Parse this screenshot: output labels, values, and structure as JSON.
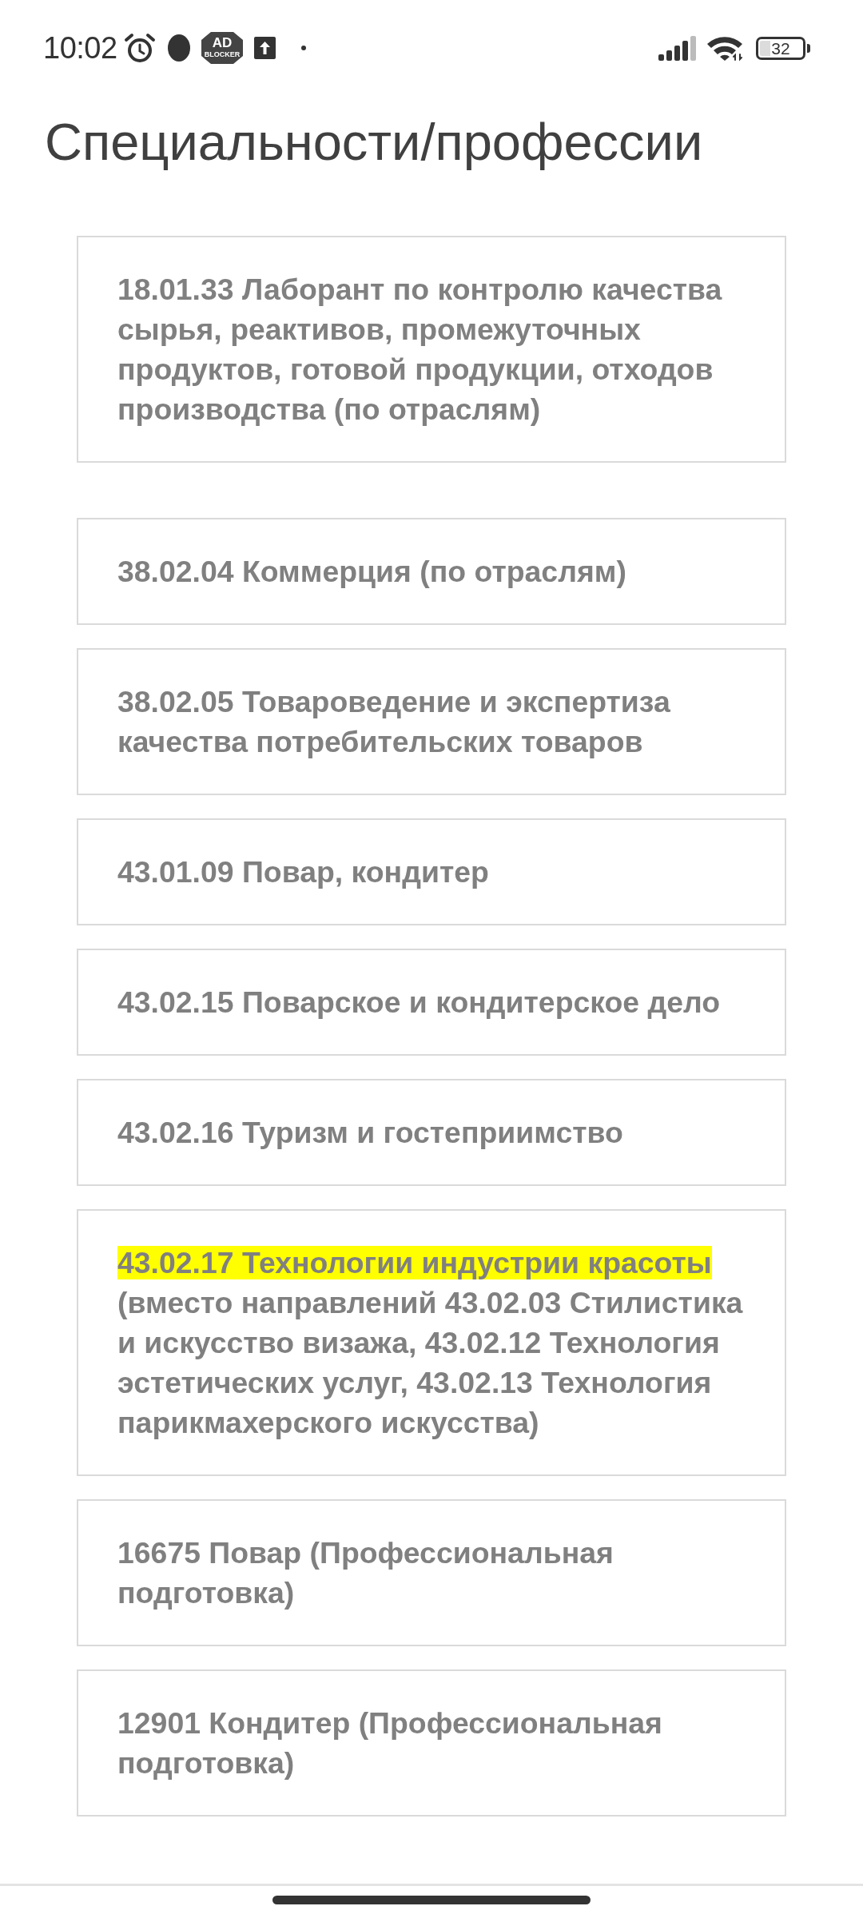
{
  "status_bar": {
    "time": "10:02",
    "ad_blocker_icon": {
      "line_1": "AD",
      "line_2": "BLOCKER"
    },
    "battery": "32"
  },
  "title": "Специальности/профессии",
  "groups": [
    {
      "items": [
        {
          "segments": [
            {
              "text": "18.01.33 Лаборант по контролю качества сырья, реактивов, промежуточных продуктов, готовой продукции, отходов производства (по отраслям)",
              "highlighted": false
            }
          ]
        }
      ]
    },
    {
      "items": [
        {
          "segments": [
            {
              "text": "38.02.04 Коммерция (по отраслям)",
              "highlighted": false
            }
          ]
        },
        {
          "segments": [
            {
              "text": "38.02.05 Товароведение и экспертиза качества потребительских товаров",
              "highlighted": false
            }
          ]
        },
        {
          "segments": [
            {
              "text": "43.01.09 Повар, кондитер",
              "highlighted": false
            }
          ]
        },
        {
          "segments": [
            {
              "text": "43.02.15 Поварское и кондитерское дело",
              "highlighted": false
            }
          ]
        },
        {
          "segments": [
            {
              "text": "43.02.16 Туризм и гостеприимство",
              "highlighted": false
            }
          ]
        },
        {
          "segments": [
            {
              "text": "43.02.17 Технологии индустрии красоты",
              "highlighted": true
            },
            {
              "text": "(вместо направлений 43.02.03 Стилистика и искусство визажа, 43.02.12 Технология эстетических услуг, 43.02.13 Технология парикмахерского искусства)",
              "highlighted": false
            }
          ]
        },
        {
          "segments": [
            {
              "text": "16675 Повар (Профессиональная подготовка)",
              "highlighted": false
            }
          ]
        },
        {
          "segments": [
            {
              "text": "12901 Кондитер (Профессиональная подготовка)",
              "highlighted": false
            }
          ]
        }
      ]
    }
  ]
}
